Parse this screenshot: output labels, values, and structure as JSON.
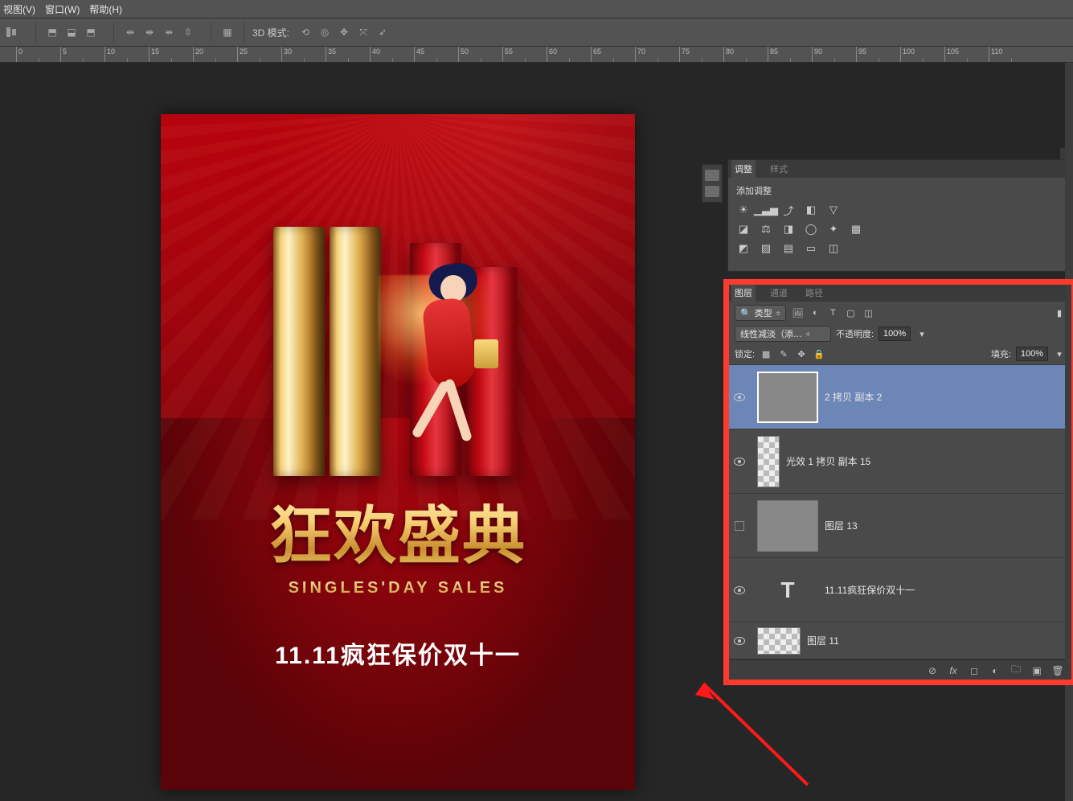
{
  "menubar": {
    "view": "视图(V)",
    "window": "窗口(W)",
    "help": "帮助(H)"
  },
  "options": {
    "mode_label": "3D 模式:"
  },
  "ruler_ticks": [
    0,
    5,
    10,
    15,
    20,
    25,
    30,
    35,
    40,
    45,
    50,
    55,
    60,
    65,
    70,
    75,
    80,
    85,
    90,
    95,
    100,
    105,
    110
  ],
  "canvas": {
    "headline_cn": "狂欢盛典",
    "headline_en": "SINGLES'DAY SALES",
    "subline": "11.11疯狂保价双十一"
  },
  "adjustments": {
    "tab1": "调整",
    "tab2": "样式",
    "title": "添加调整"
  },
  "layers_panel": {
    "tabs": {
      "layers": "图层",
      "channels": "通道",
      "paths": "路径"
    },
    "kind_label": "类型",
    "blend_mode": "线性减淡（添…",
    "opacity_label": "不透明度:",
    "opacity_value": "100%",
    "lock_label": "锁定:",
    "fill_label": "填充:",
    "fill_value": "100%",
    "layers": [
      {
        "name": "2 拷贝 副本 2",
        "type": "sparkle",
        "visible": true,
        "selected": true
      },
      {
        "name": "光效 1 拷贝 副本 15",
        "type": "light",
        "visible": true,
        "selected": false
      },
      {
        "name": "图层 13",
        "type": "box",
        "visible": false,
        "selected": false
      },
      {
        "name": "11.11疯狂保价双十一",
        "type": "text",
        "visible": true,
        "selected": false
      },
      {
        "name": "图层 11",
        "type": "light",
        "visible": true,
        "selected": false
      }
    ]
  }
}
